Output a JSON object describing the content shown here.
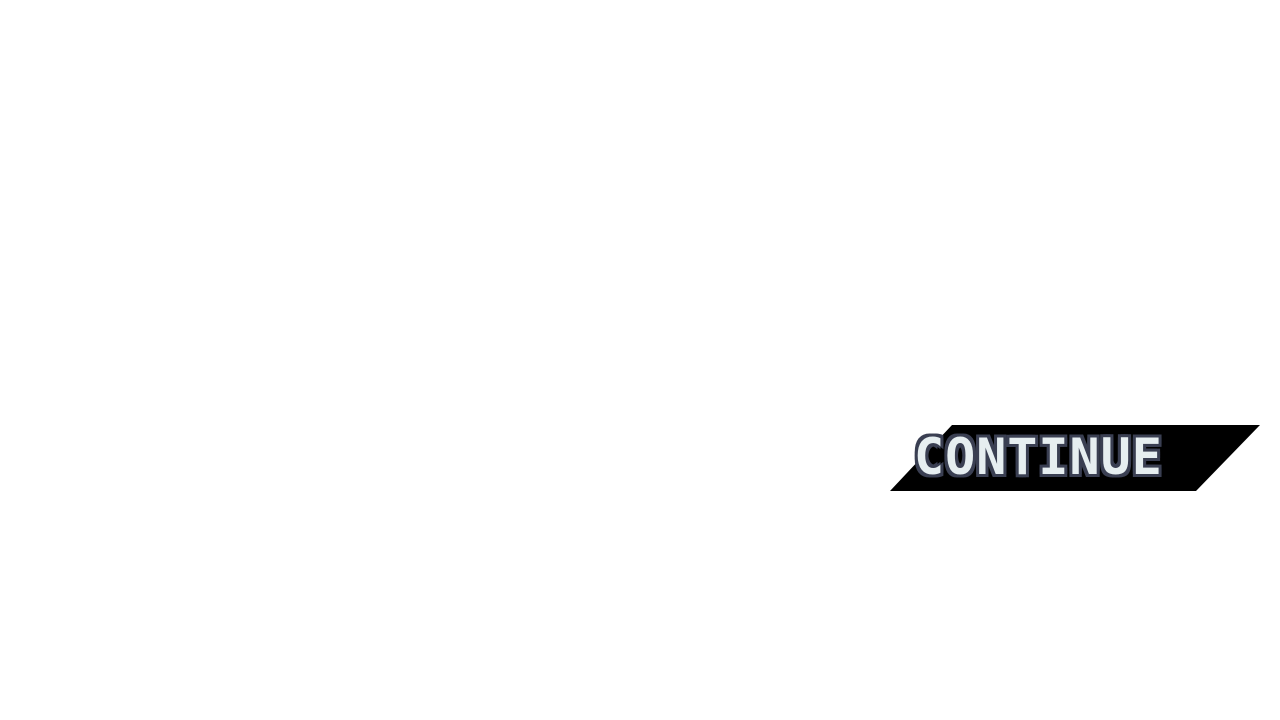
{
  "screen": {
    "background_color": "#ffffff"
  },
  "continue_button": {
    "label": "CONTINUE",
    "banner_color": "#000000",
    "text_color": "#e6eef0",
    "outline_color": "#3a3f52"
  }
}
